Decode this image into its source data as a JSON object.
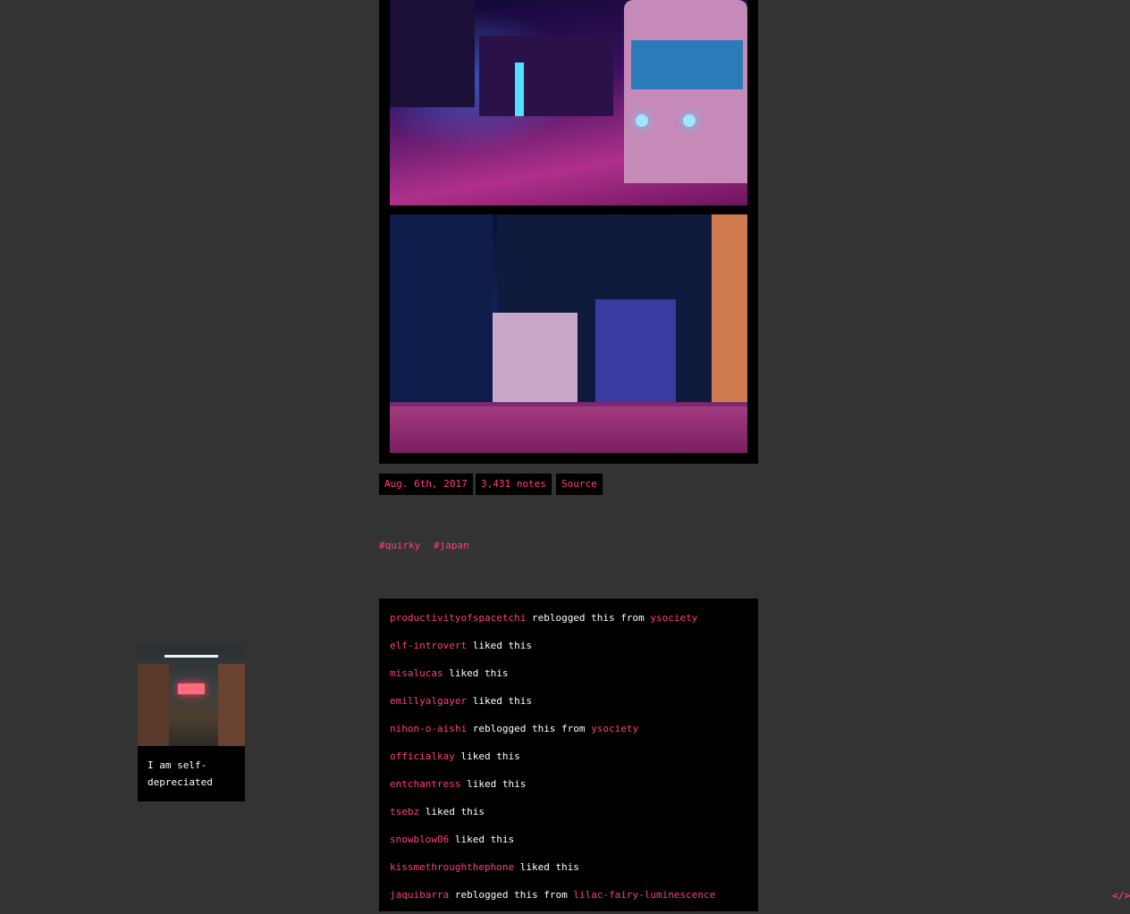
{
  "post": {
    "date": "Aug. 6th, 2017",
    "notes_count": "3,431 notes",
    "source_label": "Source",
    "tags": [
      "#quirky",
      "#japan"
    ]
  },
  "notes": [
    {
      "user": "productivityofspacetchi",
      "action": "reblogged this from",
      "from": "ysociety"
    },
    {
      "user": "elf-introvert",
      "action": "liked this",
      "from": ""
    },
    {
      "user": "misalucas",
      "action": "liked this",
      "from": ""
    },
    {
      "user": "emillyalgayer",
      "action": "liked this",
      "from": ""
    },
    {
      "user": "nihon-o-aishi",
      "action": "reblogged this from",
      "from": "ysociety"
    },
    {
      "user": "officialkay",
      "action": "liked this",
      "from": ""
    },
    {
      "user": "entchantress",
      "action": "liked this",
      "from": ""
    },
    {
      "user": "tsebz",
      "action": "liked this",
      "from": ""
    },
    {
      "user": "snowblow06",
      "action": "liked this",
      "from": ""
    },
    {
      "user": "kissmethroughthephone",
      "action": "liked this",
      "from": ""
    },
    {
      "user": "jaquibarra",
      "action": "reblogged this from",
      "from": "lilac-fairy-luminescence"
    }
  ],
  "sidebar": {
    "description": "I am self-depreciated"
  },
  "footer": {
    "code_icon": "</>"
  },
  "colors": {
    "background": "#333333",
    "accent": "#ff3e84",
    "panel": "#000000"
  }
}
